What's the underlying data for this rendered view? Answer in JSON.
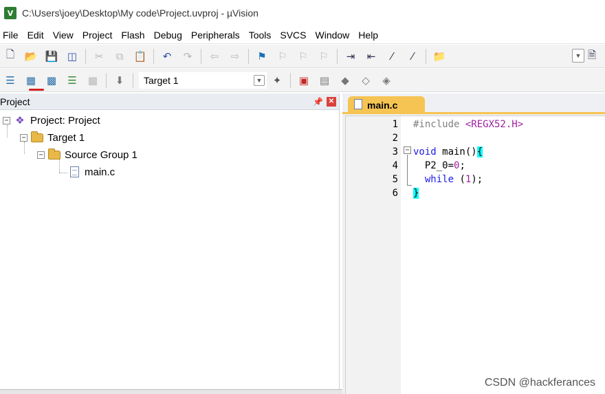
{
  "window": {
    "title": "C:\\Users\\joey\\Desktop\\My code\\Project.uvproj - µVision",
    "app_icon_letter": "V"
  },
  "menu": [
    "File",
    "Edit",
    "View",
    "Project",
    "Flash",
    "Debug",
    "Peripherals",
    "Tools",
    "SVCS",
    "Window",
    "Help"
  ],
  "toolbar2": {
    "target": "Target 1"
  },
  "project_panel": {
    "title": "Project",
    "tree": {
      "project": "Project: Project",
      "target": "Target 1",
      "group": "Source Group 1",
      "file": "main.c"
    }
  },
  "editor": {
    "tab_label": "main.c",
    "line_numbers": [
      "1",
      "2",
      "3",
      "4",
      "5",
      "6"
    ],
    "code": {
      "l1_pp": "#include ",
      "l1_str": "<REGX52.H>",
      "l3_kw": "void",
      "l3_rest": " main()",
      "l3_brace": "{",
      "l4_text": "  P2_0=",
      "l4_num": "0",
      "l4_end": ";",
      "l5_indent": "  ",
      "l5_kw": "while",
      "l5_open": " (",
      "l5_num": "1",
      "l5_close": ");",
      "l6_brace": "}"
    }
  },
  "watermark": "CSDN @hackferances",
  "colors": {
    "tab_accent": "#f6c452",
    "keyword": "#1a1ae6",
    "preprocessor": "#808080",
    "string": "#a01fa0",
    "brace_highlight": "#00ffff",
    "close_button": "#d9423b"
  }
}
